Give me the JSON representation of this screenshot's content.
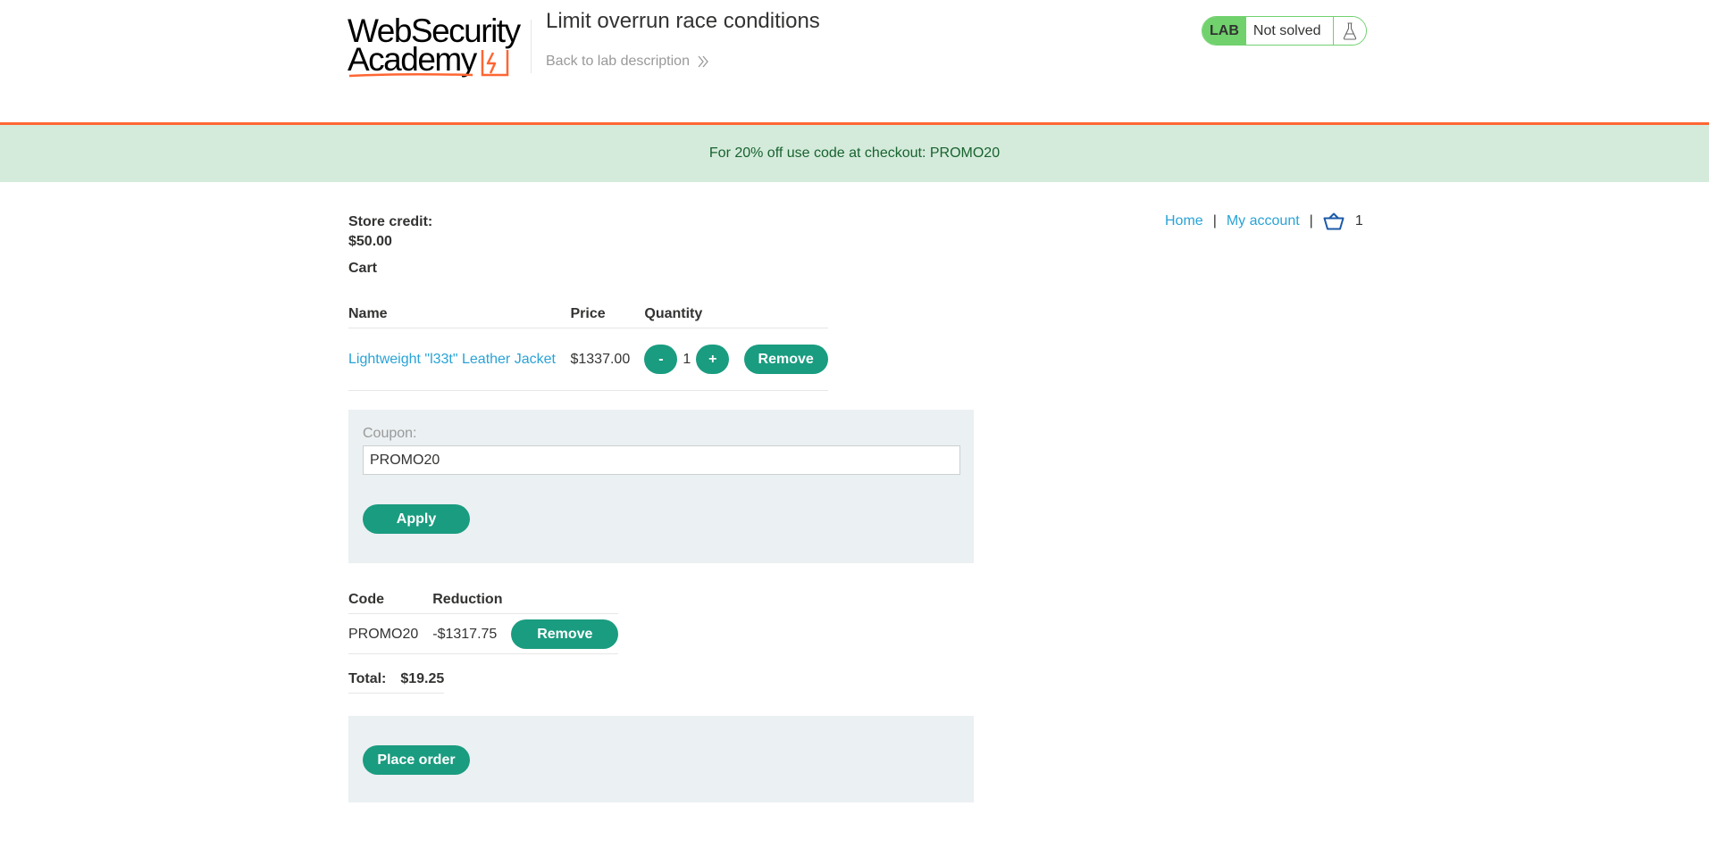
{
  "header": {
    "logo_line1": "WebSecurity",
    "logo_line2": "Academy",
    "lab_title": "Limit overrun race conditions",
    "back_link": "Back to lab description",
    "lab_badge": "LAB",
    "lab_status": "Not solved"
  },
  "banner": {
    "text": "For 20% off use code at checkout: PROMO20"
  },
  "nav": {
    "home": "Home",
    "my_account": "My account",
    "separator": "|",
    "cart_count": "1"
  },
  "store_credit": {
    "label": "Store credit:",
    "value": "$50.00"
  },
  "cart": {
    "heading": "Cart",
    "columns": [
      "Name",
      "Price",
      "Quantity"
    ],
    "items": [
      {
        "name": "Lightweight \"l33t\" Leather Jacket",
        "price": "$1337.00",
        "quantity": "1",
        "decrement_label": "-",
        "increment_label": "+",
        "remove_label": "Remove"
      }
    ]
  },
  "coupon": {
    "label": "Coupon:",
    "value": "PROMO20",
    "apply_label": "Apply"
  },
  "applied_codes": {
    "columns": [
      "Code",
      "Reduction"
    ],
    "rows": [
      {
        "code": "PROMO20",
        "reduction": "-$1317.75",
        "remove_label": "Remove"
      }
    ]
  },
  "total": {
    "label": "Total:",
    "value": "$19.25"
  },
  "order": {
    "place_order_label": "Place order"
  },
  "colors": {
    "accent_orange": "#ff6633",
    "button_green": "#1a9c80",
    "link_blue": "#29a3d6",
    "banner_bg": "#d4ebdb",
    "banner_text": "#18622f",
    "lab_green": "#70d16d",
    "panel_bg": "#ebf0f2"
  },
  "icons": {
    "logo_mark": "lightning-bolt-icon",
    "back": "double-chevron-right-icon",
    "lab": "flask-icon",
    "cart": "basket-icon"
  }
}
